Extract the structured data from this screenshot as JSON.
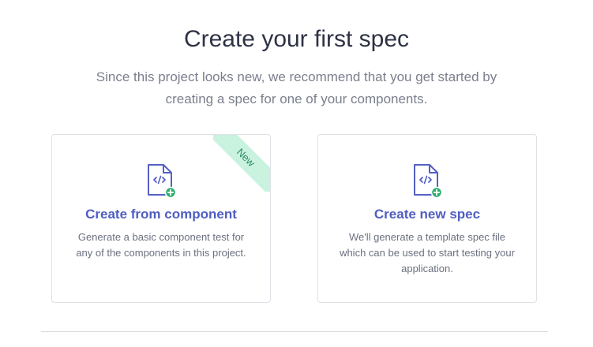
{
  "header": {
    "title": "Create your first spec",
    "subtitle": "Since this project looks new, we recommend that you get started by creating a spec for one of your components."
  },
  "cards": [
    {
      "title": "Create from component",
      "description": "Generate a basic component test for any of the components in this project.",
      "badge": "New",
      "icon": "file-code-plus-icon"
    },
    {
      "title": "Create new spec",
      "description": "We'll generate a template spec file which can be used to start testing your application.",
      "icon": "file-code-plus-icon"
    }
  ],
  "colors": {
    "title_text": "#2e3244",
    "subtitle_text": "#7a7f8c",
    "accent": "#4f5ec0",
    "badge_bg": "#c9f2df",
    "badge_text": "#2f8c66",
    "plus_green": "#2fae6f"
  }
}
